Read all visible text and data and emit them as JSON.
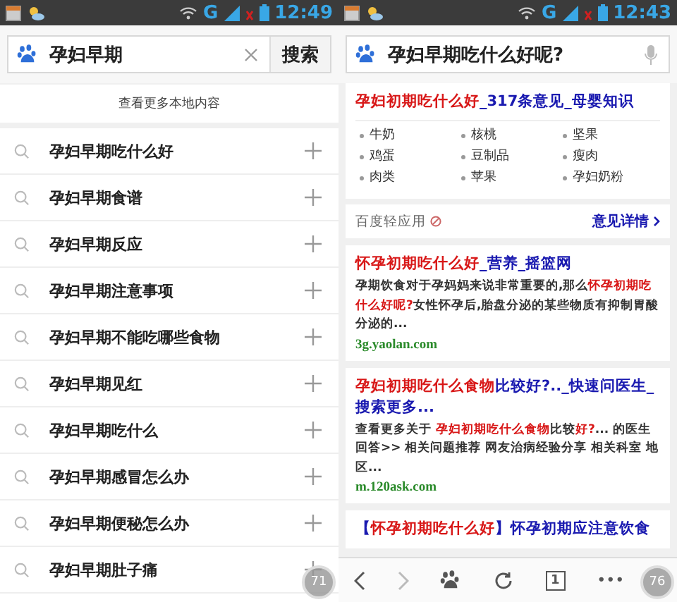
{
  "left": {
    "status_bar": {
      "network": "G",
      "time": "12:49"
    },
    "search": {
      "value": "孕妇早期",
      "button": "搜索"
    },
    "more_local": "查看更多本地内容",
    "suggestions": [
      "孕妇早期吃什么好",
      "孕妇早期食谱",
      "孕妇早期反应",
      "孕妇早期注意事项",
      "孕妇早期不能吃哪些食物",
      "孕妇早期见红",
      "孕妇早期吃什么",
      "孕妇早期感冒怎么办",
      "孕妇早期便秘怎么办",
      "孕妇早期肚子痛"
    ],
    "badge": "71"
  },
  "right": {
    "status_bar": {
      "network": "G",
      "time": "12:43"
    },
    "search": {
      "value": "孕妇早期吃什么好呢?"
    },
    "results": [
      {
        "kind": "app",
        "title": [
          {
            "text": "孕妇初期吃什么好",
            "hl": true
          },
          {
            "text": "_317条意见_母婴知识",
            "hl": false
          }
        ],
        "items": [
          "牛奶",
          "核桃",
          "坚果",
          "鸡蛋",
          "豆制品",
          "瘦肉",
          "肉类",
          "苹果",
          "孕妇奶粉"
        ],
        "source": "百度轻应用",
        "feedback": "意见详情"
      },
      {
        "kind": "web",
        "title": [
          {
            "text": "怀孕初期吃什么好",
            "hl": true
          },
          {
            "text": "_营养_摇篮网",
            "hl": false
          }
        ],
        "snippet": [
          {
            "text": "孕期饮食对于孕妈妈来说非常重要的,那么",
            "hl": false
          },
          {
            "text": "怀孕初期吃什么好呢?",
            "hl": true
          },
          {
            "text": "女性怀孕后,胎盘分泌的某些物质有抑制胃酸分泌的...",
            "hl": false
          }
        ],
        "url": "3g.yaolan.com"
      },
      {
        "kind": "web",
        "title": [
          {
            "text": "孕妇初期吃什么食物",
            "hl": true
          },
          {
            "text": "比较好?.._快速问医生_搜索更多...",
            "hl": false
          }
        ],
        "snippet": [
          {
            "text": "查看更多关于 ",
            "hl": false
          },
          {
            "text": "孕妇初期吃什么食物",
            "hl": true
          },
          {
            "text": "比较",
            "hl": false
          },
          {
            "text": "好?",
            "hl": true
          },
          {
            "text": "... 的医生回答>> 相关问题推荐 网友治病经验分享 相关科室 地区...",
            "hl": false
          }
        ],
        "url": "m.120ask.com"
      },
      {
        "kind": "web",
        "title": [
          {
            "text": "【",
            "hl": false
          },
          {
            "text": "怀孕初期吃什么好",
            "hl": true
          },
          {
            "text": "】怀孕初期应注意饮食",
            "hl": false
          }
        ]
      }
    ],
    "tab_count": "1",
    "more": "•••",
    "badge": "76"
  }
}
